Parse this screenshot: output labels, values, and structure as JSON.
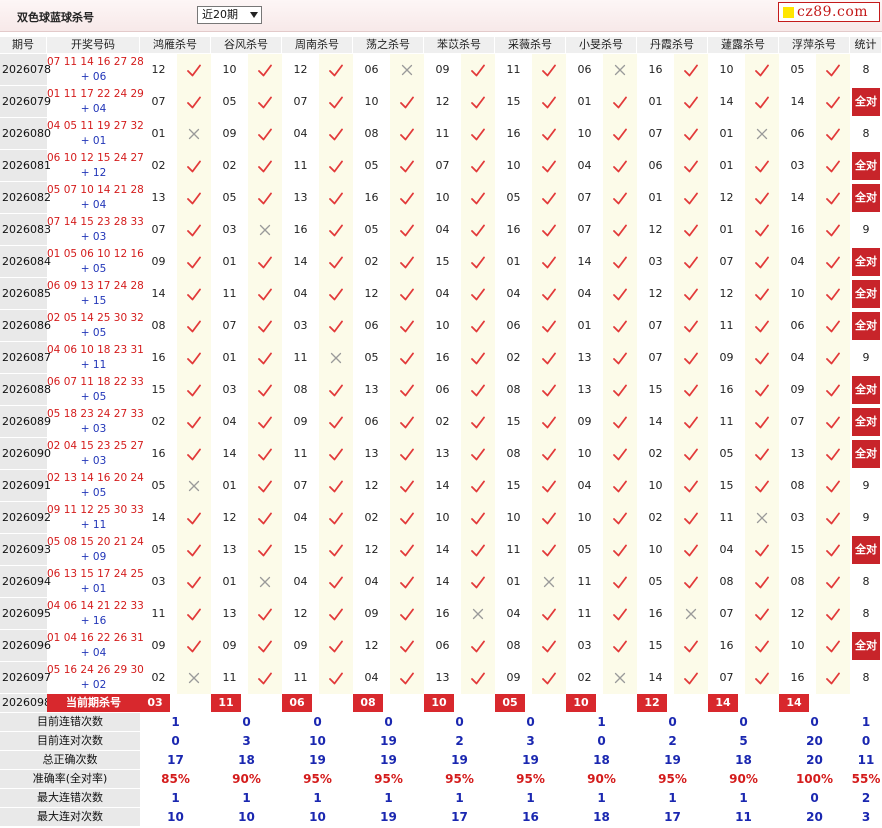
{
  "header": {
    "title": "双色球蓝球杀号",
    "period_selected": "近20期",
    "logo": "cz89.com"
  },
  "columns": [
    "期号",
    "开奖号码",
    "鸿雁杀号",
    "谷风杀号",
    "周南杀号",
    "荡之杀号",
    "苯苡杀号",
    "采薇杀号",
    "小旻杀号",
    "丹霞杀号",
    "蘧露杀号",
    "浮萍杀号",
    "统计"
  ],
  "rows": [
    {
      "issue": "2026078",
      "red": "07 11 14 16 27 28",
      "blue": "+ 06",
      "kills": [
        [
          "12",
          1
        ],
        [
          "10",
          1
        ],
        [
          "12",
          1
        ],
        [
          "06",
          0
        ],
        [
          "09",
          1
        ],
        [
          "11",
          1
        ],
        [
          "06",
          0
        ],
        [
          "16",
          1
        ],
        [
          "10",
          1
        ],
        [
          "05",
          1
        ]
      ],
      "stat": "8"
    },
    {
      "issue": "2026079",
      "red": "01 11 17 22 24 29",
      "blue": "+ 04",
      "kills": [
        [
          "07",
          1
        ],
        [
          "05",
          1
        ],
        [
          "07",
          1
        ],
        [
          "10",
          1
        ],
        [
          "12",
          1
        ],
        [
          "15",
          1
        ],
        [
          "01",
          1
        ],
        [
          "01",
          1
        ],
        [
          "14",
          1
        ],
        [
          "14",
          1
        ]
      ],
      "stat": "全对"
    },
    {
      "issue": "2026080",
      "red": "04 05 11 19 27 32",
      "blue": "+ 01",
      "kills": [
        [
          "01",
          0
        ],
        [
          "09",
          1
        ],
        [
          "04",
          1
        ],
        [
          "08",
          1
        ],
        [
          "11",
          1
        ],
        [
          "16",
          1
        ],
        [
          "10",
          1
        ],
        [
          "07",
          1
        ],
        [
          "01",
          0
        ],
        [
          "06",
          1
        ]
      ],
      "stat": "8"
    },
    {
      "issue": "2026081",
      "red": "06 10 12 15 24 27",
      "blue": "+ 12",
      "kills": [
        [
          "02",
          1
        ],
        [
          "02",
          1
        ],
        [
          "11",
          1
        ],
        [
          "05",
          1
        ],
        [
          "07",
          1
        ],
        [
          "10",
          1
        ],
        [
          "04",
          1
        ],
        [
          "06",
          1
        ],
        [
          "01",
          1
        ],
        [
          "03",
          1
        ]
      ],
      "stat": "全对"
    },
    {
      "issue": "2026082",
      "red": "05 07 10 14 21 28",
      "blue": "+ 04",
      "kills": [
        [
          "13",
          1
        ],
        [
          "05",
          1
        ],
        [
          "13",
          1
        ],
        [
          "16",
          1
        ],
        [
          "10",
          1
        ],
        [
          "05",
          1
        ],
        [
          "07",
          1
        ],
        [
          "01",
          1
        ],
        [
          "12",
          1
        ],
        [
          "14",
          1
        ]
      ],
      "stat": "全对"
    },
    {
      "issue": "2026083",
      "red": "07 14 15 23 28 33",
      "blue": "+ 03",
      "kills": [
        [
          "07",
          1
        ],
        [
          "03",
          0
        ],
        [
          "16",
          1
        ],
        [
          "05",
          1
        ],
        [
          "04",
          1
        ],
        [
          "16",
          1
        ],
        [
          "07",
          1
        ],
        [
          "12",
          1
        ],
        [
          "01",
          1
        ],
        [
          "16",
          1
        ]
      ],
      "stat": "9"
    },
    {
      "issue": "2026084",
      "red": "01 05 06 10 12 16",
      "blue": "+ 05",
      "kills": [
        [
          "09",
          1
        ],
        [
          "01",
          1
        ],
        [
          "14",
          1
        ],
        [
          "02",
          1
        ],
        [
          "15",
          1
        ],
        [
          "01",
          1
        ],
        [
          "14",
          1
        ],
        [
          "03",
          1
        ],
        [
          "07",
          1
        ],
        [
          "04",
          1
        ]
      ],
      "stat": "全对"
    },
    {
      "issue": "2026085",
      "red": "06 09 13 17 24 28",
      "blue": "+ 15",
      "kills": [
        [
          "14",
          1
        ],
        [
          "11",
          1
        ],
        [
          "04",
          1
        ],
        [
          "12",
          1
        ],
        [
          "04",
          1
        ],
        [
          "04",
          1
        ],
        [
          "04",
          1
        ],
        [
          "12",
          1
        ],
        [
          "12",
          1
        ],
        [
          "10",
          1
        ]
      ],
      "stat": "全对"
    },
    {
      "issue": "2026086",
      "red": "02 05 14 25 30 32",
      "blue": "+ 05",
      "kills": [
        [
          "08",
          1
        ],
        [
          "07",
          1
        ],
        [
          "03",
          1
        ],
        [
          "06",
          1
        ],
        [
          "10",
          1
        ],
        [
          "06",
          1
        ],
        [
          "01",
          1
        ],
        [
          "07",
          1
        ],
        [
          "11",
          1
        ],
        [
          "06",
          1
        ]
      ],
      "stat": "全对"
    },
    {
      "issue": "2026087",
      "red": "04 06 10 18 23 31",
      "blue": "+ 11",
      "kills": [
        [
          "16",
          1
        ],
        [
          "01",
          1
        ],
        [
          "11",
          0
        ],
        [
          "05",
          1
        ],
        [
          "16",
          1
        ],
        [
          "02",
          1
        ],
        [
          "13",
          1
        ],
        [
          "07",
          1
        ],
        [
          "09",
          1
        ],
        [
          "04",
          1
        ]
      ],
      "stat": "9"
    },
    {
      "issue": "2026088",
      "red": "06 07 11 18 22 33",
      "blue": "+ 05",
      "kills": [
        [
          "15",
          1
        ],
        [
          "03",
          1
        ],
        [
          "08",
          1
        ],
        [
          "13",
          1
        ],
        [
          "06",
          1
        ],
        [
          "08",
          1
        ],
        [
          "13",
          1
        ],
        [
          "15",
          1
        ],
        [
          "16",
          1
        ],
        [
          "09",
          1
        ]
      ],
      "stat": "全对"
    },
    {
      "issue": "2026089",
      "red": "05 18 23 24 27 33",
      "blue": "+ 03",
      "kills": [
        [
          "02",
          1
        ],
        [
          "04",
          1
        ],
        [
          "09",
          1
        ],
        [
          "06",
          1
        ],
        [
          "02",
          1
        ],
        [
          "15",
          1
        ],
        [
          "09",
          1
        ],
        [
          "14",
          1
        ],
        [
          "11",
          1
        ],
        [
          "07",
          1
        ]
      ],
      "stat": "全对"
    },
    {
      "issue": "2026090",
      "red": "02 04 15 23 25 27",
      "blue": "+ 03",
      "kills": [
        [
          "16",
          1
        ],
        [
          "14",
          1
        ],
        [
          "11",
          1
        ],
        [
          "13",
          1
        ],
        [
          "13",
          1
        ],
        [
          "08",
          1
        ],
        [
          "10",
          1
        ],
        [
          "02",
          1
        ],
        [
          "05",
          1
        ],
        [
          "13",
          1
        ]
      ],
      "stat": "全对"
    },
    {
      "issue": "2026091",
      "red": "02 13 14 16 20 24",
      "blue": "+ 05",
      "kills": [
        [
          "05",
          0
        ],
        [
          "01",
          1
        ],
        [
          "07",
          1
        ],
        [
          "12",
          1
        ],
        [
          "14",
          1
        ],
        [
          "15",
          1
        ],
        [
          "04",
          1
        ],
        [
          "10",
          1
        ],
        [
          "15",
          1
        ],
        [
          "08",
          1
        ]
      ],
      "stat": "9"
    },
    {
      "issue": "2026092",
      "red": "09 11 12 25 30 33",
      "blue": "+ 11",
      "kills": [
        [
          "14",
          1
        ],
        [
          "12",
          1
        ],
        [
          "04",
          1
        ],
        [
          "02",
          1
        ],
        [
          "10",
          1
        ],
        [
          "10",
          1
        ],
        [
          "10",
          1
        ],
        [
          "02",
          1
        ],
        [
          "11",
          0
        ],
        [
          "03",
          1
        ]
      ],
      "stat": "9"
    },
    {
      "issue": "2026093",
      "red": "05 08 15 20 21 24",
      "blue": "+ 09",
      "kills": [
        [
          "05",
          1
        ],
        [
          "13",
          1
        ],
        [
          "15",
          1
        ],
        [
          "12",
          1
        ],
        [
          "14",
          1
        ],
        [
          "11",
          1
        ],
        [
          "05",
          1
        ],
        [
          "10",
          1
        ],
        [
          "04",
          1
        ],
        [
          "15",
          1
        ]
      ],
      "stat": "全对"
    },
    {
      "issue": "2026094",
      "red": "06 13 15 17 24 25",
      "blue": "+ 01",
      "kills": [
        [
          "03",
          1
        ],
        [
          "01",
          0
        ],
        [
          "04",
          1
        ],
        [
          "04",
          1
        ],
        [
          "14",
          1
        ],
        [
          "01",
          0
        ],
        [
          "11",
          1
        ],
        [
          "05",
          1
        ],
        [
          "08",
          1
        ],
        [
          "08",
          1
        ]
      ],
      "stat": "8"
    },
    {
      "issue": "2026095",
      "red": "04 06 14 21 22 33",
      "blue": "+ 16",
      "kills": [
        [
          "11",
          1
        ],
        [
          "13",
          1
        ],
        [
          "12",
          1
        ],
        [
          "09",
          1
        ],
        [
          "16",
          0
        ],
        [
          "04",
          1
        ],
        [
          "11",
          1
        ],
        [
          "16",
          0
        ],
        [
          "07",
          1
        ],
        [
          "12",
          1
        ]
      ],
      "stat": "8"
    },
    {
      "issue": "2026096",
      "red": "01 04 16 22 26 31",
      "blue": "+ 04",
      "kills": [
        [
          "09",
          1
        ],
        [
          "09",
          1
        ],
        [
          "09",
          1
        ],
        [
          "12",
          1
        ],
        [
          "06",
          1
        ],
        [
          "08",
          1
        ],
        [
          "03",
          1
        ],
        [
          "15",
          1
        ],
        [
          "16",
          1
        ],
        [
          "10",
          1
        ]
      ],
      "stat": "全对"
    },
    {
      "issue": "2026097",
      "red": "05 16 24 26 29 30",
      "blue": "+ 02",
      "kills": [
        [
          "02",
          0
        ],
        [
          "11",
          1
        ],
        [
          "11",
          1
        ],
        [
          "04",
          1
        ],
        [
          "13",
          1
        ],
        [
          "09",
          1
        ],
        [
          "02",
          0
        ],
        [
          "14",
          1
        ],
        [
          "07",
          1
        ],
        [
          "16",
          1
        ]
      ],
      "stat": "8"
    }
  ],
  "current": {
    "issue": "2026098",
    "label": "当前期杀号",
    "kills": [
      "03",
      "11",
      "06",
      "08",
      "10",
      "05",
      "10",
      "12",
      "14",
      "14"
    ]
  },
  "summary": [
    {
      "label": "目前连错次数",
      "values": [
        "1",
        "0",
        "0",
        "0",
        "0",
        "0",
        "1",
        "0",
        "0",
        "0",
        "1"
      ],
      "pct": false
    },
    {
      "label": "目前连对次数",
      "values": [
        "0",
        "3",
        "10",
        "19",
        "2",
        "3",
        "0",
        "2",
        "5",
        "20",
        "0"
      ],
      "pct": false
    },
    {
      "label": "总正确次数",
      "values": [
        "17",
        "18",
        "19",
        "19",
        "19",
        "19",
        "18",
        "19",
        "18",
        "20",
        "11"
      ],
      "pct": false
    },
    {
      "label": "准确率(全对率)",
      "values": [
        "85%",
        "90%",
        "95%",
        "95%",
        "95%",
        "95%",
        "90%",
        "95%",
        "90%",
        "100%",
        "55%"
      ],
      "pct": true
    },
    {
      "label": "最大连错次数",
      "values": [
        "1",
        "1",
        "1",
        "1",
        "1",
        "1",
        "1",
        "1",
        "1",
        "0",
        "2"
      ],
      "pct": false
    },
    {
      "label": "最大连对次数",
      "values": [
        "10",
        "10",
        "10",
        "19",
        "17",
        "16",
        "18",
        "17",
        "11",
        "20",
        "3"
      ],
      "pct": false
    }
  ],
  "colors": {
    "accent_red": "#c8242a",
    "blue": "#1a27b0",
    "tick": "#e23a3a",
    "cross": "#9a9a9a",
    "mark_bg": "#fcfbe9"
  }
}
